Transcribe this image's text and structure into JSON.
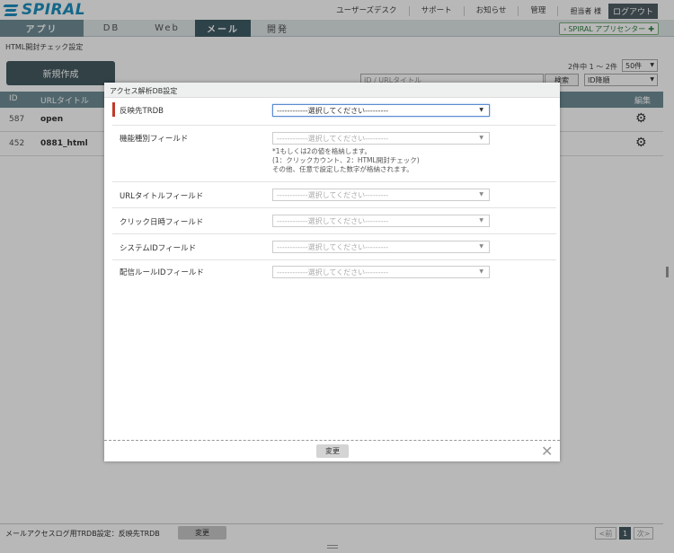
{
  "header": {
    "logo_text": "SPIRAL",
    "links": [
      "ユーザーズデスク",
      "サポート",
      "お知らせ",
      "管理"
    ],
    "user": "担当者 様",
    "logout": "ログアウト",
    "app_center": "SPIRAL アプリセンター"
  },
  "tabs": {
    "app": "アプリ",
    "db": "DB",
    "web": "Web",
    "mail": "メール",
    "dev": "開発"
  },
  "page": {
    "subtitle": "HTML開封チェック設定",
    "new_button": "新規作成",
    "count": "2件中 1 ～ 2件",
    "per_page": "50件",
    "search_placeholder": "ID / URLタイトル",
    "search_button": "検索",
    "sort": "ID降順",
    "columns": {
      "id": "ID",
      "url_title": "URLタイトル",
      "edit": "編集"
    },
    "rows": [
      {
        "id": "587",
        "title": "open"
      },
      {
        "id": "452",
        "title": "0881_html"
      }
    ],
    "footer_label": "メールアクセスログ用TRDB設定：反映先TRDB",
    "footer_change": "変更",
    "pager": {
      "prev": "<前",
      "current": "1",
      "next": "次>"
    }
  },
  "modal": {
    "title": "アクセス解析DB設定",
    "fields": [
      {
        "label": "反映先TRDB",
        "value": "------------選択してください---------"
      },
      {
        "label": "機能種別フィールド",
        "value": "------------選択してください---------"
      },
      {
        "label": "URLタイトルフィールド",
        "value": "------------選択してください---------"
      },
      {
        "label": "クリック日時フィールド",
        "value": "------------選択してください---------"
      },
      {
        "label": "システムIDフィールド",
        "value": "------------選択してください---------"
      },
      {
        "label": "配信ルールIDフィールド",
        "value": "------------選択してください---------"
      }
    ],
    "note_lines": [
      "*1もしくは2の値を格納します。",
      "(1：クリックカウント、2：HTML開封チェック)",
      "その他、任意で設定した数字が格納されます。"
    ],
    "change": "変更",
    "close_icon": "close-icon"
  },
  "colors": {
    "brand": "#1d8fbf",
    "tab_active": "#3f5d66",
    "table_header": "#6f8e96",
    "required_marker": "#c0392b"
  }
}
